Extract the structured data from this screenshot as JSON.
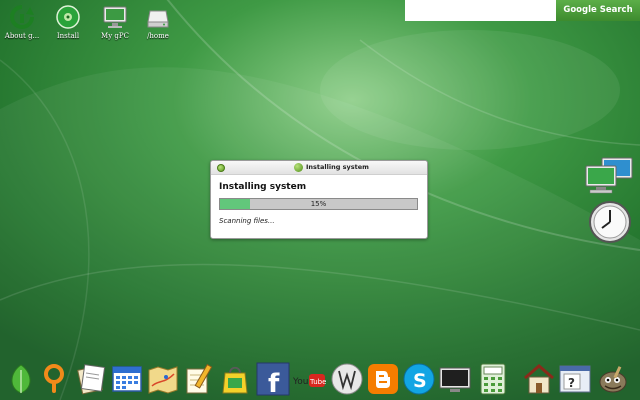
{
  "desktop": {
    "icons": [
      {
        "label": "About g...",
        "icon": "info-refresh-icon"
      },
      {
        "label": "Install",
        "icon": "install-disc-icon"
      },
      {
        "label": "My gPC",
        "icon": "computer-monitor-icon"
      },
      {
        "label": "/home",
        "icon": "drive-icon"
      }
    ]
  },
  "search": {
    "value": "",
    "button_label": "Google Search"
  },
  "dialog": {
    "title": "Installing system",
    "heading": "Installing system",
    "progress_percent": 15,
    "progress_text": "15%",
    "status": "Scanning files..."
  },
  "widgets": [
    "network-computers-icon",
    "clock-icon"
  ],
  "dock": [
    "leaf-icon",
    "search-magnifier-icon",
    "document-icon",
    "calendar-icon",
    "map-icon",
    "notepad-pencil-icon",
    "shopping-bag-icon",
    "facebook-icon",
    "youtube-icon",
    "wikipedia-icon",
    "blogger-icon",
    "skype-icon",
    "monitor-icon",
    "calculator-icon",
    "home-icon",
    "help-icon",
    "gimp-icon"
  ],
  "colors": {
    "wallpaper": "#2f8a3a",
    "progress_fill": "#62c77b",
    "search_button": "#4a9b3a"
  }
}
